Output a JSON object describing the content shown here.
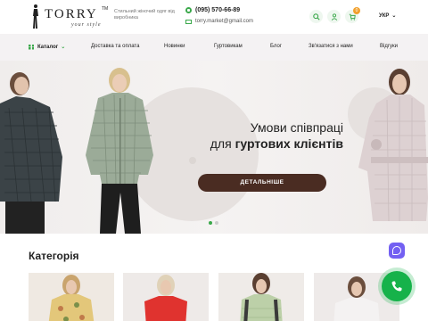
{
  "header": {
    "brand": "TORRY",
    "brand_tm": "TM",
    "brand_sub": "your style",
    "tagline": "Стильний жіночий одяг від виробника",
    "phone": "(095) 570-66-89",
    "email": "torry.market@gmail.com",
    "cart_count": "0",
    "language": "УКР",
    "accent_color": "#3aa84a"
  },
  "nav": {
    "catalog": "Каталог",
    "items": [
      "Доставка та оплата",
      "Новинки",
      "Гуртовикам",
      "Блог",
      "Зв'язатися з нами",
      "Відгуки"
    ]
  },
  "hero": {
    "title_line1": "Умови співпраці",
    "title_line2_normal": "для ",
    "title_line2_bold": "гуртових клієнтів",
    "button": "ДЕТАЛЬНІШЕ",
    "button_color": "#4a2c22",
    "slides_total": 2,
    "active_slide": 1
  },
  "categories": {
    "title": "Категорія"
  }
}
